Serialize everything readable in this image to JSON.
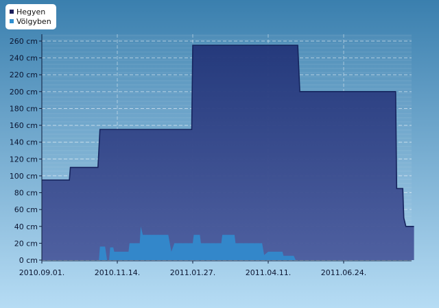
{
  "chart_data": {
    "type": "area",
    "title": "",
    "xlabel": "",
    "ylabel": "",
    "x_range": [
      "2010-09-01",
      "2011-09-01"
    ],
    "ylim": [
      0,
      265
    ],
    "y_ticks": [
      0,
      20,
      40,
      60,
      80,
      100,
      120,
      140,
      160,
      180,
      200,
      220,
      240,
      260
    ],
    "y_unit": "cm",
    "x_ticks": [
      {
        "date": "2010-09-01",
        "label": "2010.09.01."
      },
      {
        "date": "2010-11-14",
        "label": "2010.11.14."
      },
      {
        "date": "2011-01-27",
        "label": "2011.01.27."
      },
      {
        "date": "2011-04-11",
        "label": "2011.04.11."
      },
      {
        "date": "2011-06-24",
        "label": "2011.06.24."
      }
    ],
    "grid": true,
    "legend_position": "top-left",
    "series": [
      {
        "name": "Hegyen",
        "color": "#1b2c6e",
        "points": [
          [
            "2010-09-01",
            95
          ],
          [
            "2010-09-28",
            95
          ],
          [
            "2010-09-29",
            110
          ],
          [
            "2010-10-26",
            110
          ],
          [
            "2010-10-28",
            155
          ],
          [
            "2011-01-26",
            155
          ],
          [
            "2011-01-27",
            255
          ],
          [
            "2011-05-10",
            255
          ],
          [
            "2011-05-12",
            200
          ],
          [
            "2011-08-14",
            200
          ],
          [
            "2011-08-15",
            85
          ],
          [
            "2011-08-21",
            85
          ],
          [
            "2011-08-22",
            50
          ],
          [
            "2011-08-24",
            40
          ],
          [
            "2011-09-01",
            40
          ]
        ]
      },
      {
        "name": "Völgyben",
        "color": "#2e86c9",
        "points": [
          [
            "2010-09-01",
            0
          ],
          [
            "2010-10-27",
            0
          ],
          [
            "2010-10-28",
            16
          ],
          [
            "2010-11-02",
            16
          ],
          [
            "2010-11-04",
            0
          ],
          [
            "2010-11-06",
            0
          ],
          [
            "2010-11-07",
            15
          ],
          [
            "2010-11-10",
            15
          ],
          [
            "2010-11-11",
            10
          ],
          [
            "2010-11-25",
            10
          ],
          [
            "2010-11-26",
            20
          ],
          [
            "2010-12-06",
            20
          ],
          [
            "2010-12-07",
            40
          ],
          [
            "2010-12-09",
            30
          ],
          [
            "2011-01-03",
            30
          ],
          [
            "2011-01-06",
            10
          ],
          [
            "2011-01-09",
            20
          ],
          [
            "2011-01-27",
            20
          ],
          [
            "2011-01-28",
            30
          ],
          [
            "2011-02-03",
            30
          ],
          [
            "2011-02-04",
            20
          ],
          [
            "2011-02-24",
            20
          ],
          [
            "2011-02-25",
            30
          ],
          [
            "2011-03-09",
            30
          ],
          [
            "2011-03-10",
            20
          ],
          [
            "2011-04-05",
            20
          ],
          [
            "2011-04-07",
            6
          ],
          [
            "2011-04-11",
            10
          ],
          [
            "2011-04-25",
            10
          ],
          [
            "2011-04-26",
            5
          ],
          [
            "2011-05-06",
            5
          ],
          [
            "2011-05-08",
            0
          ],
          [
            "2011-09-01",
            0
          ]
        ]
      }
    ]
  },
  "legend": {
    "items": [
      {
        "label": "Hegyen",
        "color": "#1b1f5c"
      },
      {
        "label": "Völgyben",
        "color": "#2f8fd0"
      }
    ]
  },
  "colors": {
    "background_top": "#3a7fae",
    "background_bottom": "#b6dcf4",
    "hegyen_fill": "#283b82",
    "hegyen_line": "#16245e",
    "volgyben_fill": "#3189cc"
  }
}
